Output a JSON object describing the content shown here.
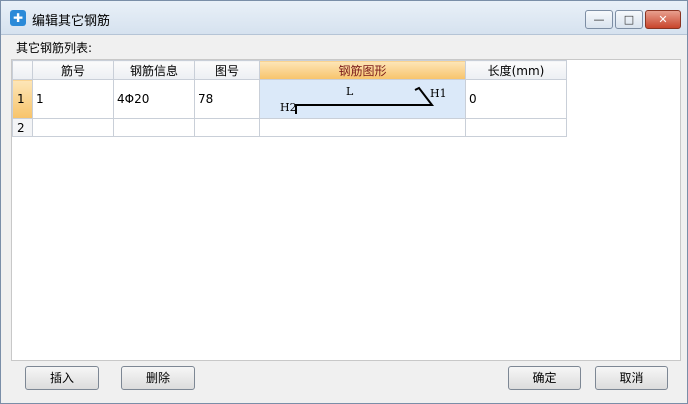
{
  "window": {
    "title": "编辑其它钢筋",
    "icon": "app-icon",
    "min_label": "—",
    "max_label": "□",
    "close_label": "✕"
  },
  "list_label": "其它钢筋列表:",
  "table": {
    "headers": [
      "",
      "筋号",
      "钢筋信息",
      "图号",
      "钢筋图形",
      "长度(mm)"
    ],
    "rows": [
      {
        "num": "1",
        "bar_no": "1",
        "info": "4Φ20",
        "fig_no": "78",
        "shape": {
          "L": "L",
          "H1": "H1",
          "H2": "H2"
        },
        "length": "0"
      },
      {
        "num": "2",
        "bar_no": "",
        "info": "",
        "fig_no": "",
        "length": ""
      }
    ]
  },
  "buttons": {
    "insert": "插入",
    "delete": "删除",
    "ok": "确定",
    "cancel": "取消"
  },
  "colors": {
    "active_header": "#f7c36a",
    "selected_cell": "#dbe9f9"
  }
}
